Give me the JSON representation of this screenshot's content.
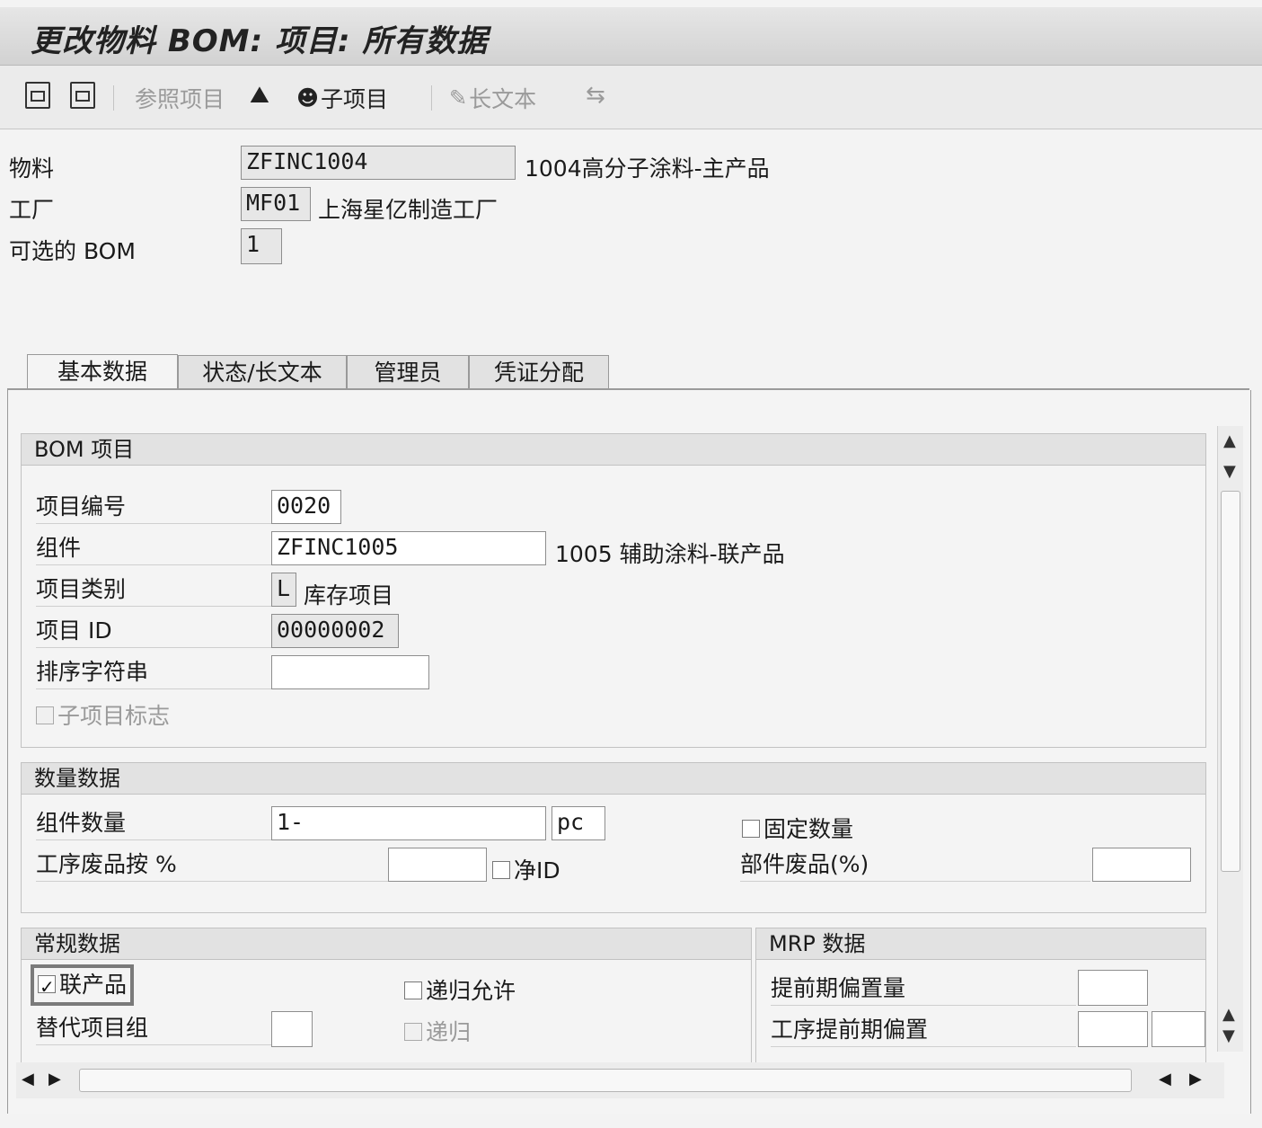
{
  "window": {
    "title": "更改物料 BOM: 项目: 所有数据"
  },
  "toolbar": {
    "ref_item": "参照项目",
    "sub_item": "子项目",
    "long_text": "长文本"
  },
  "header": {
    "material_label": "物料",
    "material_value": "ZFINC1004",
    "material_desc": "1004高分子涂料-主产品",
    "plant_label": "工厂",
    "plant_value": "MF01",
    "plant_desc": "上海星亿制造工厂",
    "alt_bom_label": "可选的 BOM",
    "alt_bom_value": "1"
  },
  "tabs": [
    {
      "label": "基本数据"
    },
    {
      "label": "状态/长文本"
    },
    {
      "label": "管理员"
    },
    {
      "label": "凭证分配"
    }
  ],
  "bom_item": {
    "title": "BOM 项目",
    "item_no_label": "项目编号",
    "item_no_value": "0020",
    "component_label": "组件",
    "component_value": "ZFINC1005",
    "component_desc": "1005 辅助涂料-联产品",
    "item_cat_label": "项目类别",
    "item_cat_value": "L",
    "item_cat_desc": "库存项目",
    "item_id_label": "项目 ID",
    "item_id_value": "00000002",
    "sort_string_label": "排序字符串",
    "sort_string_value": "",
    "sub_item_flag_label": "子项目标志"
  },
  "quantity": {
    "title": "数量数据",
    "comp_qty_label": "组件数量",
    "comp_qty_value": "1-",
    "unit_value": "pc",
    "fixed_qty_label": "固定数量",
    "op_scrap_label": "工序废品按 %",
    "op_scrap_value": "",
    "net_id_label": "净ID",
    "comp_scrap_label": "部件废品(%)",
    "comp_scrap_value": ""
  },
  "general": {
    "title": "常规数据",
    "co_product_label": "联产品",
    "recursive_allowed_label": "递归允许",
    "alt_group_label": "替代项目组",
    "alt_group_value": "",
    "recursive_label": "递归"
  },
  "mrp": {
    "title": "MRP 数据",
    "lead_offset_label": "提前期偏置量",
    "op_lead_offset_label": "工序提前期偏置"
  }
}
